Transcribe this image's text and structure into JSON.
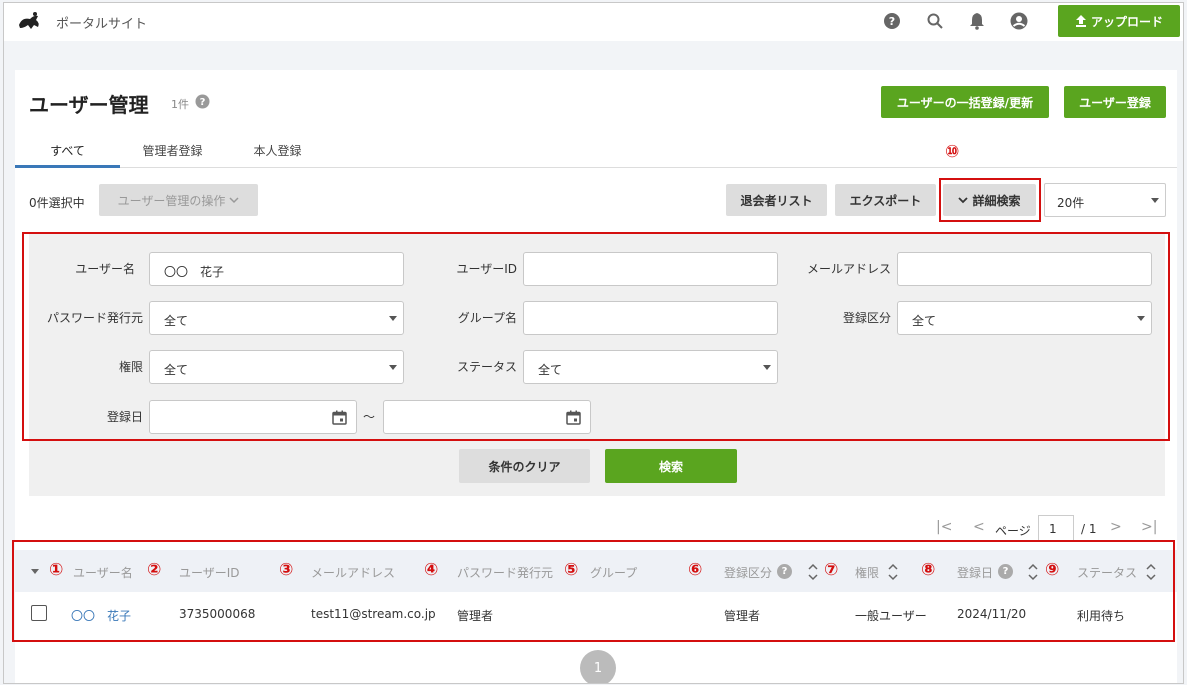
{
  "header": {
    "app_title": "ポータルサイト",
    "upload_label": "アップロード"
  },
  "page": {
    "title": "ユーザー管理",
    "count": "1件",
    "bulk_button": "ユーザーの一括登録/更新",
    "register_button": "ユーザー登録"
  },
  "tabs": [
    {
      "label": "すべて"
    },
    {
      "label": "管理者登録"
    },
    {
      "label": "本人登録"
    }
  ],
  "toolbar": {
    "selected_count": "0件選択中",
    "ops_label": "ユーザー管理の操作",
    "withdrawn_list": "退会者リスト",
    "export": "エクスポート",
    "advanced_search": "詳細検索",
    "per_page": "20件"
  },
  "annotations": {
    "n1": "①",
    "n2": "②",
    "n3": "③",
    "n4": "④",
    "n5": "⑤",
    "n6": "⑥",
    "n7": "⑦",
    "n8": "⑧",
    "n9": "⑨",
    "n10": "⑩"
  },
  "filters": {
    "username_label": "ユーザー名",
    "username_value": "〇〇　花子",
    "userid_label": "ユーザーID",
    "userid_value": "",
    "email_label": "メールアドレス",
    "email_value": "",
    "pw_issuer_label": "パスワード発行元",
    "pw_issuer_value": "全て",
    "group_label": "グループ名",
    "group_value": "",
    "reg_type_label": "登録区分",
    "reg_type_value": "全て",
    "role_label": "権限",
    "role_value": "全て",
    "status_label": "ステータス",
    "status_value": "全て",
    "reg_date_label": "登録日",
    "range_sep": "～",
    "clear_button": "条件のクリア",
    "search_button": "検索"
  },
  "pagination": {
    "page_label": "ページ",
    "current_page": "1",
    "total": "/ 1",
    "bottom_page": "1"
  },
  "table": {
    "headers": {
      "username": "ユーザー名",
      "userid": "ユーザーID",
      "email": "メールアドレス",
      "pw_issuer": "パスワード発行元",
      "group": "グループ",
      "reg_type": "登録区分",
      "role": "権限",
      "reg_date": "登録日",
      "status": "ステータス"
    },
    "rows": [
      {
        "username": "〇〇　花子",
        "userid": "3735000068",
        "email": "test11@stream.co.jp",
        "pw_issuer": "管理者",
        "group": "",
        "reg_type": "管理者",
        "role": "一般ユーザー",
        "reg_date": "2024/11/20",
        "status": "利用待ち"
      }
    ]
  },
  "colors": {
    "primary_green": "#5aa51f",
    "annotation_red": "#d40f0f",
    "link_blue": "#3a78b8"
  }
}
